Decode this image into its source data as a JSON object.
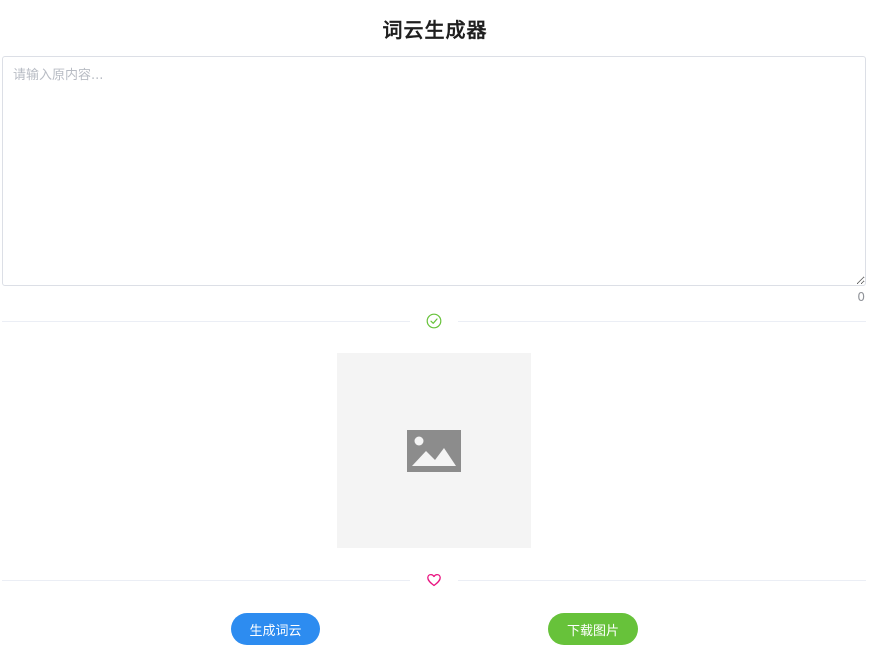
{
  "header": {
    "title": "词云生成器"
  },
  "editor": {
    "placeholder": "请输入原内容...",
    "value": "",
    "char_count": "0"
  },
  "dividers": {
    "top_icon": "check-circle-icon",
    "bottom_icon": "heart-icon"
  },
  "preview": {
    "icon": "image-placeholder-icon"
  },
  "actions": {
    "generate_label": "生成词云",
    "download_label": "下载图片"
  },
  "colors": {
    "generate_button": "#2d8cf0",
    "download_button": "#67c23a",
    "check_icon": "#67c23a",
    "heart_icon": "#e9117f",
    "image_placeholder_bg": "#f4f4f4"
  }
}
